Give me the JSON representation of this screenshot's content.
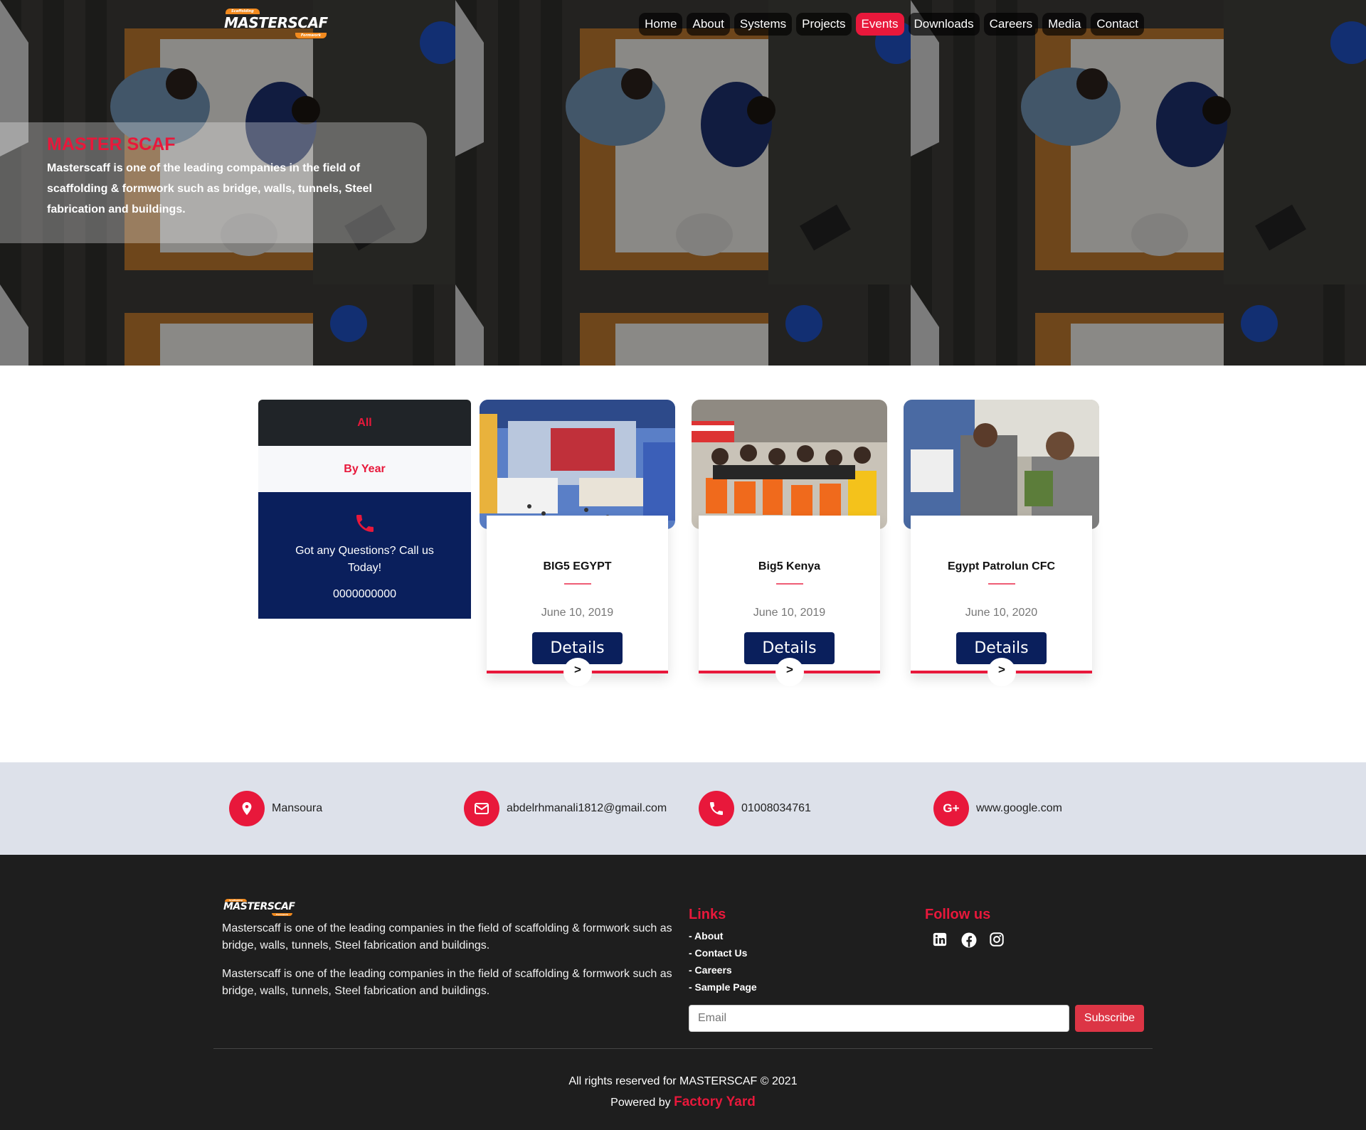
{
  "brand": {
    "tag_top": "Scaffolding",
    "name": "MASTERSCAF",
    "tag_bottom": "Formwork"
  },
  "nav": {
    "items": [
      {
        "label": "Home",
        "active": false
      },
      {
        "label": "About",
        "active": false
      },
      {
        "label": "Systems",
        "active": false
      },
      {
        "label": "Projects",
        "active": false
      },
      {
        "label": "Events",
        "active": true
      },
      {
        "label": "Downloads",
        "active": false
      },
      {
        "label": "Careers",
        "active": false
      },
      {
        "label": "Media",
        "active": false
      },
      {
        "label": "Contact",
        "active": false
      }
    ]
  },
  "hero": {
    "title": "MASTER SCAF",
    "text": "Masterscaff is one of the leading companies in the field of scaffolding & formwork such as bridge, walls, tunnels, Steel fabrication and buildings."
  },
  "sidebar": {
    "all_label": "All",
    "by_year_label": "By Year",
    "call_text": "Got any Questions? Call us Today!",
    "phone": "0000000000"
  },
  "events": [
    {
      "name": "BIG5 EGYPT",
      "date": "June 10, 2019",
      "button": "Details",
      "arrow": ">"
    },
    {
      "name": "Big5 Kenya",
      "date": "June 10, 2019",
      "button": "Details",
      "arrow": ">"
    },
    {
      "name": "Egypt Patrolun CFC",
      "date": "June 10, 2020",
      "button": "Details",
      "arrow": ">"
    }
  ],
  "contact_strip": {
    "location": "Mansoura",
    "email": "abdelrhmanali1812@gmail.com",
    "phone": "01008034761",
    "website": "www.google.com"
  },
  "footer": {
    "about_1": "Masterscaff is one of the leading companies in the field of scaffolding & formwork such as bridge, walls, tunnels, Steel fabrication and buildings.",
    "about_2": "Masterscaff is one of the leading companies in the field of scaffolding & formwork such as bridge, walls, tunnels, Steel fabrication and buildings.",
    "links_title": "Links",
    "links": [
      "- About",
      "- Contact Us",
      "- Careers",
      "- Sample Page"
    ],
    "follow_title": "Follow us",
    "social_icons": [
      "linkedin-icon",
      "facebook-icon",
      "instagram-icon"
    ],
    "email_placeholder": "Email",
    "subscribe_label": "Subscribe",
    "copyright": "All rights reserved for MASTERSCAF © 2021",
    "powered_prefix": "Powered by",
    "powered_name": "Factory Yard"
  },
  "colors": {
    "accent": "#e8183b",
    "navy": "#0a1f5c",
    "footer_bg": "#1e1e1e",
    "strip_bg": "#dde1ea"
  }
}
